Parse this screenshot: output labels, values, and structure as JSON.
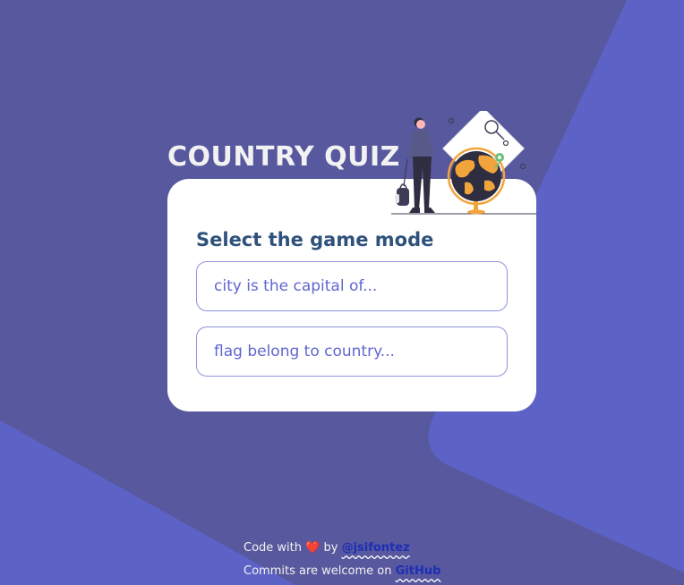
{
  "page": {
    "title": "COUNTRY QUIZ"
  },
  "card": {
    "prompt": "Select the game mode",
    "options": [
      {
        "label": "city is the capital of..."
      },
      {
        "label": "flag belong to country..."
      }
    ]
  },
  "footer": {
    "line1_prefix": "Code with",
    "heart": "❤️",
    "line1_by": "by",
    "author_link": "@jsifontez",
    "line2_prefix": "Commits are welcome on",
    "github_link": "GitHub"
  },
  "colors": {
    "background": "#57589e",
    "accent_shape": "#6066d0",
    "card": "#ffffff",
    "prompt_text": "#2f527b",
    "option_text": "#6066d0",
    "globe_land": "#f2a43c",
    "globe_ocean": "#2f2e41"
  },
  "icons": {
    "illustration": "traveler-with-globe-illustration",
    "heart": "heart-icon"
  }
}
